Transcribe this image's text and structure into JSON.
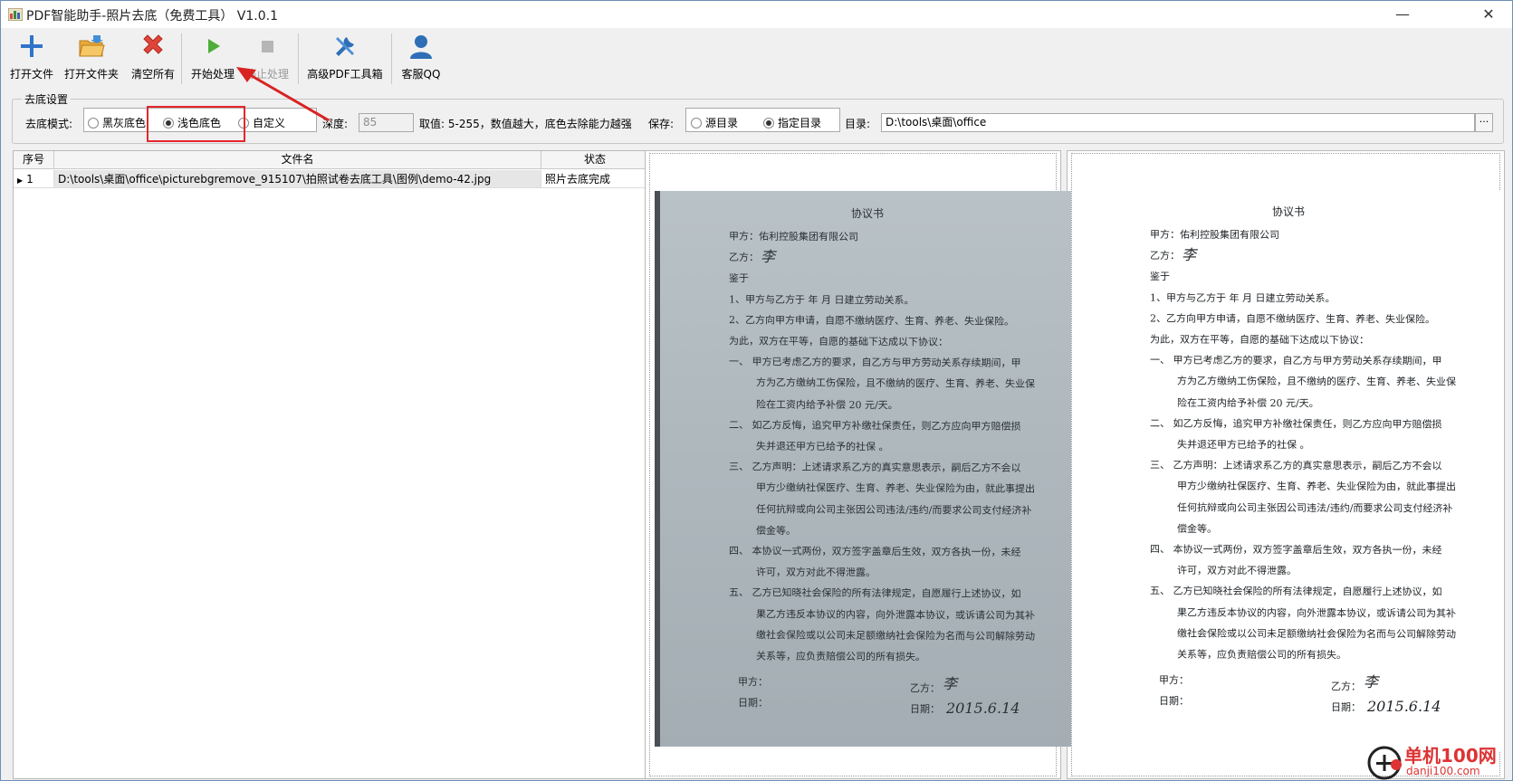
{
  "window": {
    "title": "PDF智能助手-照片去底（免费工具） V1.0.1",
    "minimize_icon": "minimize-icon",
    "close_icon": "close-icon"
  },
  "toolbar": {
    "open_file": "打开文件",
    "open_folder": "打开文件夹",
    "clear_all": "清空所有",
    "start": "开始处理",
    "stop": "停止处理",
    "advanced": "高级PDF工具箱",
    "service": "客服QQ"
  },
  "settings": {
    "group_title": "去底设置",
    "mode_label": "去底模式:",
    "mode_options": [
      "黑灰底色",
      "浅色底色",
      "自定义"
    ],
    "mode_selected": "浅色底色",
    "depth_label": "深度:",
    "depth_value": "85",
    "depth_hint": "取值: 5-255，数值越大，底色去除能力越强",
    "save_label": "保存:",
    "save_options": [
      "源目录",
      "指定目录"
    ],
    "save_selected": "指定目录",
    "dir_label": "目录:",
    "dir_value": "D:\\tools\\桌面\\office",
    "browse": "···"
  },
  "table": {
    "headers": [
      "序号",
      "文件名",
      "状态"
    ],
    "rows": [
      {
        "index": "1",
        "filename": "D:\\tools\\桌面\\office\\picturebgremove_915107\\拍照试卷去底工具\\图例\\demo-42.jpg",
        "status": "照片去底完成"
      }
    ]
  },
  "document": {
    "title": "协议书",
    "lines": [
      "甲方：佑利控股集团有限公司",
      "乙方：",
      "鉴于",
      "1、甲方与乙方于   年   月   日建立劳动关系。",
      "2、乙方向甲方申请，自愿不缴纳医疗、生育、养老、失业保险。",
      "为此，双方在平等，自愿的基础下达成以下协议：",
      "一、    甲方已考虑乙方的要求，自乙方与甲方劳动关系存续期间，甲",
      "方为乙方缴纳工伤保险，且不缴纳的医疗、生育、养老、失业保",
      "险在工资内给予补偿  20  元/天。",
      "二、    如乙方反悔，追究甲方补缴社保责任，则乙方应向甲方赔偿损",
      "失并退还甲方已给予的社保 。",
      "三、    乙方声明：上述请求系乙方的真实意思表示，嗣后乙方不会以",
      "甲方少缴纳社保医疗、生育、养老、失业保险为由，就此事提出",
      "任何抗辩或向公司主张因公司违法/违约/而要求公司支付经济补",
      "偿金等。",
      "四、    本协议一式两份，双方签字盖章后生效，双方各执一份，未经",
      "许可，双方对此不得泄露。",
      "五、    乙方已知晓社会保险的所有法律规定，自愿履行上述协议，如",
      "果乙方违反本协议的内容，向外泄露本协议，或诉请公司为其补",
      "缴社会保险或以公司未足额缴纳社会保险为名而与公司解除劳动",
      "关系等，应负责赔偿公司的所有损失。"
    ],
    "party_a": "甲方：",
    "party_b": "乙方：",
    "date_a": "日期：",
    "date_b": "日期：",
    "sig_b": "李",
    "sig_year": "15",
    "sig_month": "6",
    "sig_day": "14",
    "sig_date": "2015.6.14"
  },
  "watermark": {
    "title": "单机100网",
    "url": "danji100.com"
  }
}
